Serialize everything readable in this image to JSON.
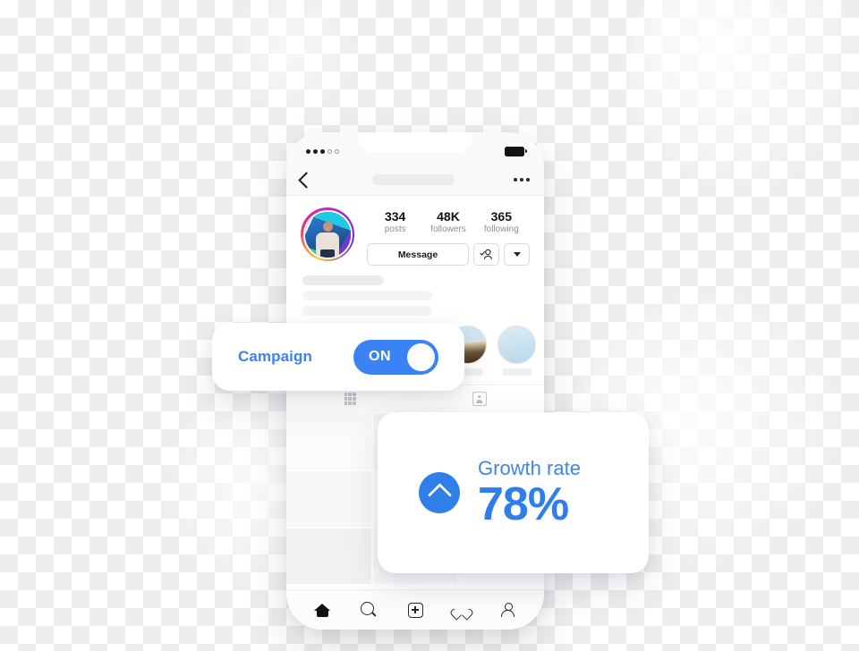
{
  "phone": {
    "status_bar": {
      "signal_dots_filled": 3,
      "signal_dots_total": 5,
      "battery_icon": "battery-full-icon"
    },
    "nav": {
      "back_icon": "chevron-left-icon",
      "more_icon": "kebab-menu-icon"
    },
    "profile": {
      "avatar_icon": "profile-avatar",
      "stats": [
        {
          "value": "334",
          "label": "posts"
        },
        {
          "value": "48K",
          "label": "followers"
        },
        {
          "value": "365",
          "label": "following"
        }
      ],
      "message_button": "Message",
      "follow_icon": "person-check-icon",
      "dropdown_icon": "caret-down-icon"
    },
    "highlights": [
      {
        "name": "highlight-1"
      },
      {
        "name": "highlight-2"
      },
      {
        "name": "highlight-3"
      },
      {
        "name": "highlight-4"
      },
      {
        "name": "highlight-5"
      }
    ],
    "profile_tabs": [
      {
        "icon": "grid-icon"
      },
      {
        "icon": "tagged-photos-icon"
      }
    ],
    "bottom_nav": [
      {
        "icon": "home-icon",
        "active": true
      },
      {
        "icon": "search-icon",
        "active": false
      },
      {
        "icon": "add-post-icon",
        "active": false
      },
      {
        "icon": "heart-icon",
        "active": false
      },
      {
        "icon": "profile-icon",
        "active": false
      }
    ]
  },
  "campaign_card": {
    "label": "Campaign",
    "toggle_state": "ON",
    "toggle_on": true,
    "accent_color": "#3b82f6"
  },
  "growth_card": {
    "title": "Growth rate",
    "value": "78%",
    "trend_icon": "chevron-up-icon",
    "accent_color": "#2f7eea"
  }
}
